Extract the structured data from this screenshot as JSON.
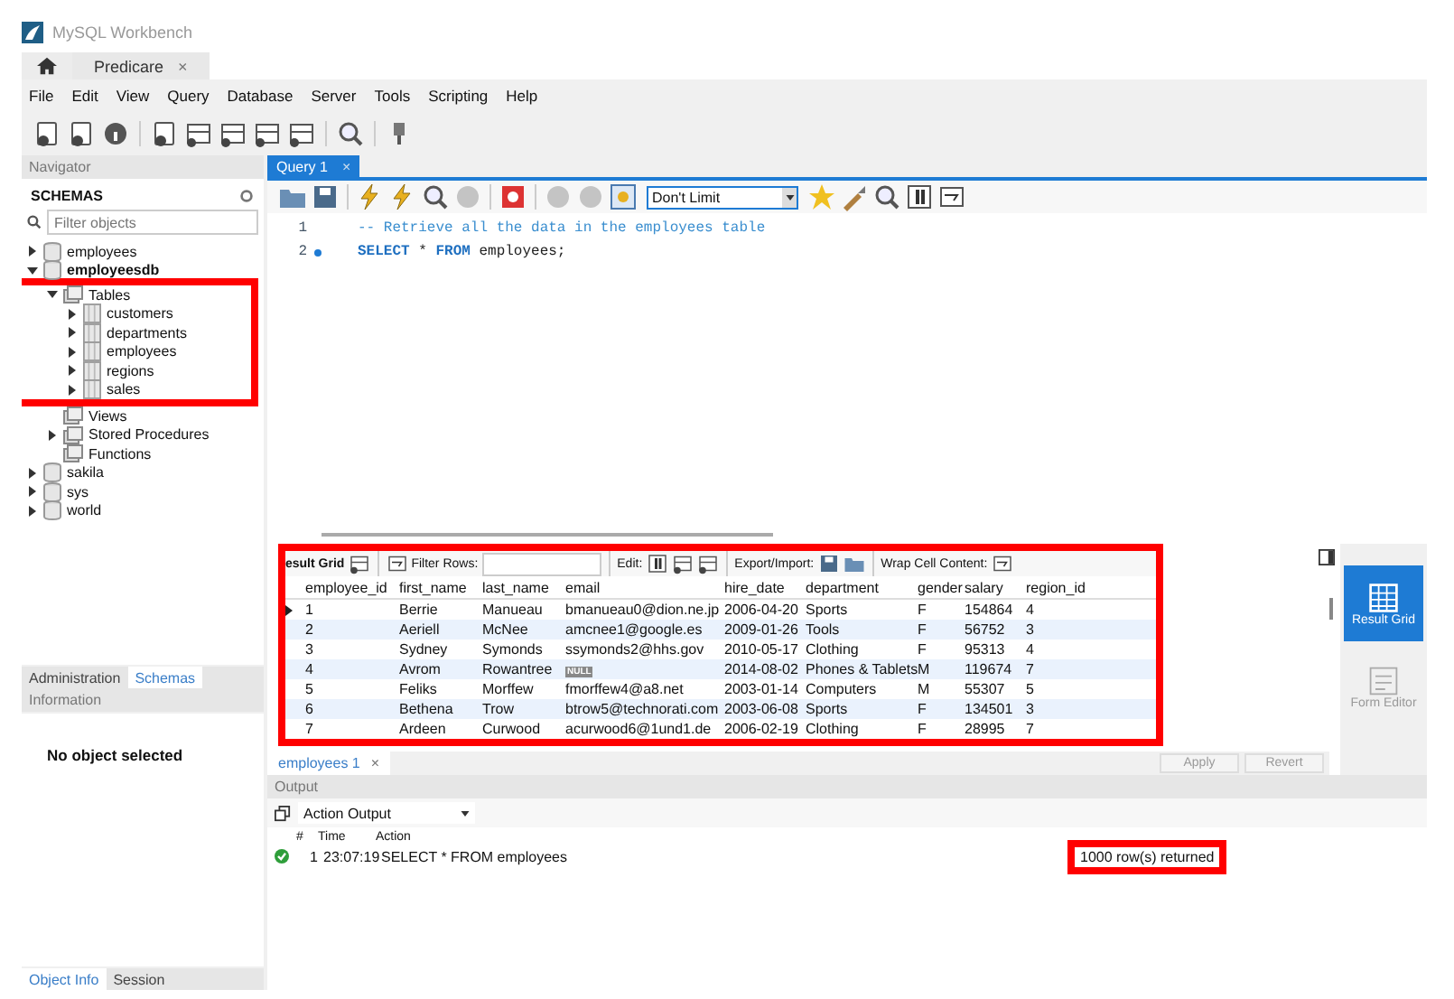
{
  "window": {
    "title": "MySQL Workbench"
  },
  "connection_tabs": [
    {
      "label": "Predicare",
      "close": "×",
      "selected": true
    }
  ],
  "menu": [
    "File",
    "Edit",
    "View",
    "Query",
    "Database",
    "Server",
    "Tools",
    "Scripting",
    "Help"
  ],
  "navigator": {
    "title": "Navigator",
    "schemas_label": "SCHEMAS",
    "filter_placeholder": "Filter objects",
    "tree": [
      {
        "label": "employees",
        "kind": "schema",
        "expanded": false,
        "default": false
      },
      {
        "label": "employeesdb",
        "kind": "schema",
        "expanded": true,
        "default": true,
        "children": [
          {
            "label": "Tables",
            "kind": "folder",
            "expanded": true,
            "highlighted": true,
            "children": [
              {
                "label": "customers",
                "kind": "table",
                "expanded": false
              },
              {
                "label": "departments",
                "kind": "table",
                "expanded": false
              },
              {
                "label": "employees",
                "kind": "table",
                "expanded": false
              },
              {
                "label": "regions",
                "kind": "table",
                "expanded": false
              },
              {
                "label": "sales",
                "kind": "table",
                "expanded": false
              }
            ]
          },
          {
            "label": "Views",
            "kind": "folder",
            "leaf": true
          },
          {
            "label": "Stored Procedures",
            "kind": "folder",
            "expanded": false
          },
          {
            "label": "Functions",
            "kind": "folder",
            "leaf": true
          }
        ]
      },
      {
        "label": "sakila",
        "kind": "schema",
        "expanded": false,
        "default": false
      },
      {
        "label": "sys",
        "kind": "schema",
        "expanded": false,
        "default": false
      },
      {
        "label": "world",
        "kind": "schema",
        "expanded": false,
        "default": false
      }
    ]
  },
  "nav_tabs": [
    {
      "label": "Administration",
      "selected": false
    },
    {
      "label": "Schemas",
      "selected": true
    }
  ],
  "information": {
    "title": "Information",
    "message": "No object selected"
  },
  "info_tabs": [
    {
      "label": "Object Info",
      "selected": true
    },
    {
      "label": "Session",
      "selected": false
    }
  ],
  "query_tabs": [
    {
      "label": "Query 1",
      "close": "×",
      "selected": true
    }
  ],
  "query_toolbar": {
    "limit": "Don't Limit"
  },
  "editor": {
    "lines": [
      {
        "number": "1",
        "marker": false,
        "tokens": [
          {
            "text": "-- Retrieve all the data in the employees table",
            "kind": "comment"
          }
        ]
      },
      {
        "number": "2",
        "marker": true,
        "tokens": [
          {
            "text": "SELECT",
            "kind": "keyword"
          },
          {
            "text": " * ",
            "kind": "plain"
          },
          {
            "text": "FROM",
            "kind": "keyword"
          },
          {
            "text": " employees;",
            "kind": "plain"
          }
        ]
      }
    ]
  },
  "result_toolbar": {
    "tab_label": "esult Grid",
    "filter_label": "Filter Rows:",
    "edit_label": "Edit:",
    "export_label": "Export/Import:",
    "wrap_label": "Wrap Cell Content:"
  },
  "grid": {
    "highlighted": true,
    "null_badge": "NULL",
    "columns": [
      "employee_id",
      "first_name",
      "last_name",
      "email",
      "hire_date",
      "department",
      "gender",
      "salary",
      "region_id"
    ],
    "rows": [
      {
        "selected": true,
        "cells": [
          "1",
          "Berrie",
          "Manueau",
          "bmanueau0@dion.ne.jp",
          "2006-04-20",
          "Sports",
          "F",
          "154864",
          "4"
        ]
      },
      {
        "selected": false,
        "cells": [
          "2",
          "Aeriell",
          "McNee",
          "amcnee1@google.es",
          "2009-01-26",
          "Tools",
          "F",
          "56752",
          "3"
        ]
      },
      {
        "selected": false,
        "cells": [
          "3",
          "Sydney",
          "Symonds",
          "ssymonds2@hhs.gov",
          "2010-05-17",
          "Clothing",
          "F",
          "95313",
          "4"
        ]
      },
      {
        "selected": false,
        "cells": [
          "4",
          "Avrom",
          "Rowantree",
          null,
          "2014-08-02",
          "Phones & Tablets",
          "M",
          "119674",
          "7"
        ]
      },
      {
        "selected": false,
        "cells": [
          "5",
          "Feliks",
          "Morffew",
          "fmorffew4@a8.net",
          "2003-01-14",
          "Computers",
          "M",
          "55307",
          "5"
        ]
      },
      {
        "selected": false,
        "cells": [
          "6",
          "Bethena",
          "Trow",
          "btrow5@technorati.com",
          "2003-06-08",
          "Sports",
          "F",
          "134501",
          "3"
        ]
      },
      {
        "selected": false,
        "cells": [
          "7",
          "Ardeen",
          "Curwood",
          "acurwood6@1und1.de",
          "2006-02-19",
          "Clothing",
          "F",
          "28995",
          "7"
        ]
      }
    ]
  },
  "side_panel": [
    {
      "label": "Result Grid",
      "kind": "grid",
      "selected": true
    },
    {
      "label": "Form Editor",
      "kind": "form",
      "selected": false
    }
  ],
  "result_tabs": [
    {
      "label": "employees 1",
      "close": "×",
      "selected": true
    }
  ],
  "result_buttons": [
    {
      "label": "Apply",
      "disabled": true
    },
    {
      "label": "Revert",
      "disabled": true
    }
  ],
  "output": {
    "title": "Output",
    "mode": "Action Output",
    "columns": [
      "#",
      "Time",
      "Action"
    ],
    "rows": [
      {
        "success": true,
        "number": "1",
        "time": "23:07:19",
        "action": "SELECT * FROM employees",
        "message": "1000 row(s) returned",
        "highlighted": true
      }
    ]
  }
}
